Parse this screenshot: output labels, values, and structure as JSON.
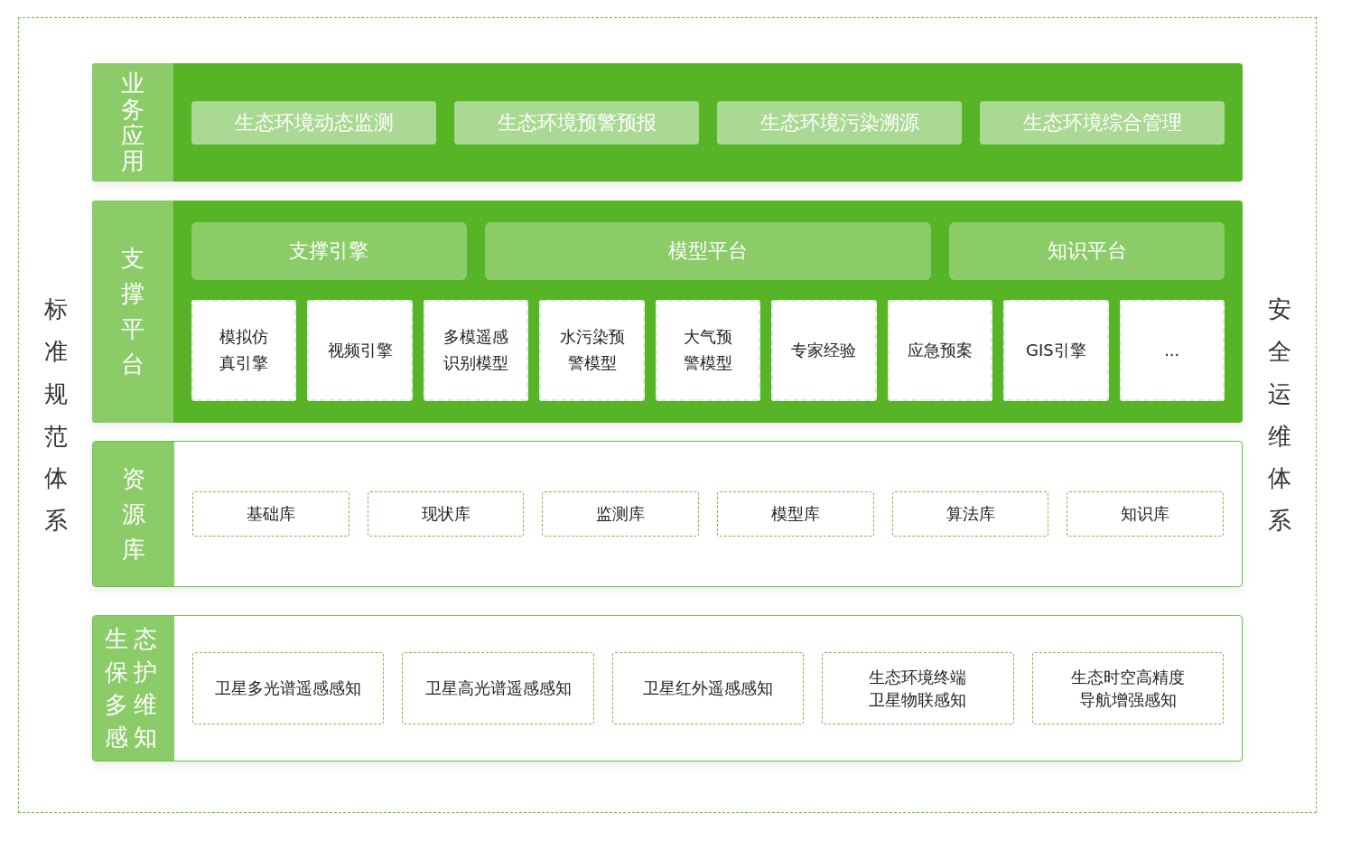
{
  "left_side_label": "标准规范体系",
  "right_side_label": "安全运维体系",
  "layers": [
    {
      "kind": "application",
      "label": "业务应用",
      "items": [
        "生态环境动态监测",
        "生态环境预警预报",
        "生态环境污染溯源",
        "生态环境综合管理"
      ]
    },
    {
      "kind": "platform",
      "label": "支撑平台",
      "groups": [
        "支撑引擎",
        "模型平台",
        "知识平台"
      ],
      "items": [
        "模拟仿真引擎",
        "视频引擎",
        "多模遥感识别模型",
        "水污染预警模型",
        "大气预警模型",
        "专家经验",
        "应急预案",
        "GIS引擎",
        "..."
      ]
    },
    {
      "kind": "resource",
      "label": "资源库",
      "items": [
        "基础库",
        "现状库",
        "监测库",
        "模型库",
        "算法库",
        "知识库"
      ]
    },
    {
      "kind": "perception",
      "label": "生态保护多维感知",
      "items": [
        "卫星多光谱遥感感知",
        "卫星高光谱遥感感知",
        "卫星红外遥感感知",
        "生态环境终端卫星物联感知",
        "生态时空高精度导航增强感知"
      ]
    }
  ]
}
